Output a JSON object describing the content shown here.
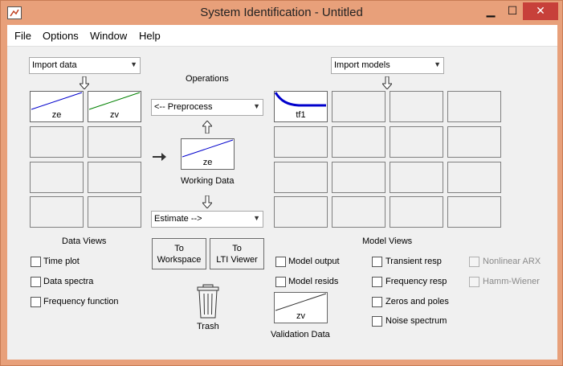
{
  "window": {
    "title": "System Identification - Untitled",
    "controls": {
      "minimize": "▁",
      "maximize": "☐",
      "close": "✕"
    },
    "border_color": "#e8a07a",
    "close_color": "#c7403a"
  },
  "menu": {
    "items": [
      {
        "label": "File"
      },
      {
        "label": "Options"
      },
      {
        "label": "Window"
      },
      {
        "label": "Help"
      }
    ]
  },
  "data_panel": {
    "import_select": "Import data",
    "tiles": [
      {
        "label": "ze",
        "line_color": "#0000cc"
      },
      {
        "label": "zv",
        "line_color": "#008000"
      }
    ],
    "views_title": "Data Views",
    "views": [
      {
        "label": "Time plot",
        "checked": false
      },
      {
        "label": "Data spectra",
        "checked": false
      },
      {
        "label": "Frequency function",
        "checked": false
      }
    ]
  },
  "operations": {
    "title": "Operations",
    "preprocess_select": "<-- Preprocess",
    "working_data": {
      "label": "ze",
      "caption": "Working Data"
    },
    "estimate_select": "Estimate -->",
    "to_workspace": {
      "line1": "To",
      "line2": "Workspace"
    },
    "to_lti_viewer": {
      "line1": "To",
      "line2": "LTI Viewer"
    },
    "trash_label": "Trash"
  },
  "model_panel": {
    "import_select": "Import models",
    "tiles": [
      {
        "label": "tf1",
        "line_color": "#0000cc"
      }
    ],
    "views_title": "Model Views",
    "views": [
      {
        "label": "Model output",
        "checked": false,
        "enabled": true
      },
      {
        "label": "Model resids",
        "checked": false,
        "enabled": true
      },
      {
        "label": "Transient resp",
        "checked": false,
        "enabled": true
      },
      {
        "label": "Frequency resp",
        "checked": false,
        "enabled": true
      },
      {
        "label": "Zeros and poles",
        "checked": false,
        "enabled": true
      },
      {
        "label": "Noise spectrum",
        "checked": false,
        "enabled": true
      },
      {
        "label": "Nonlinear ARX",
        "checked": false,
        "enabled": false
      },
      {
        "label": "Hamm-Wiener",
        "checked": false,
        "enabled": false
      }
    ],
    "validation_data": {
      "label": "zv",
      "caption": "Validation Data"
    }
  }
}
